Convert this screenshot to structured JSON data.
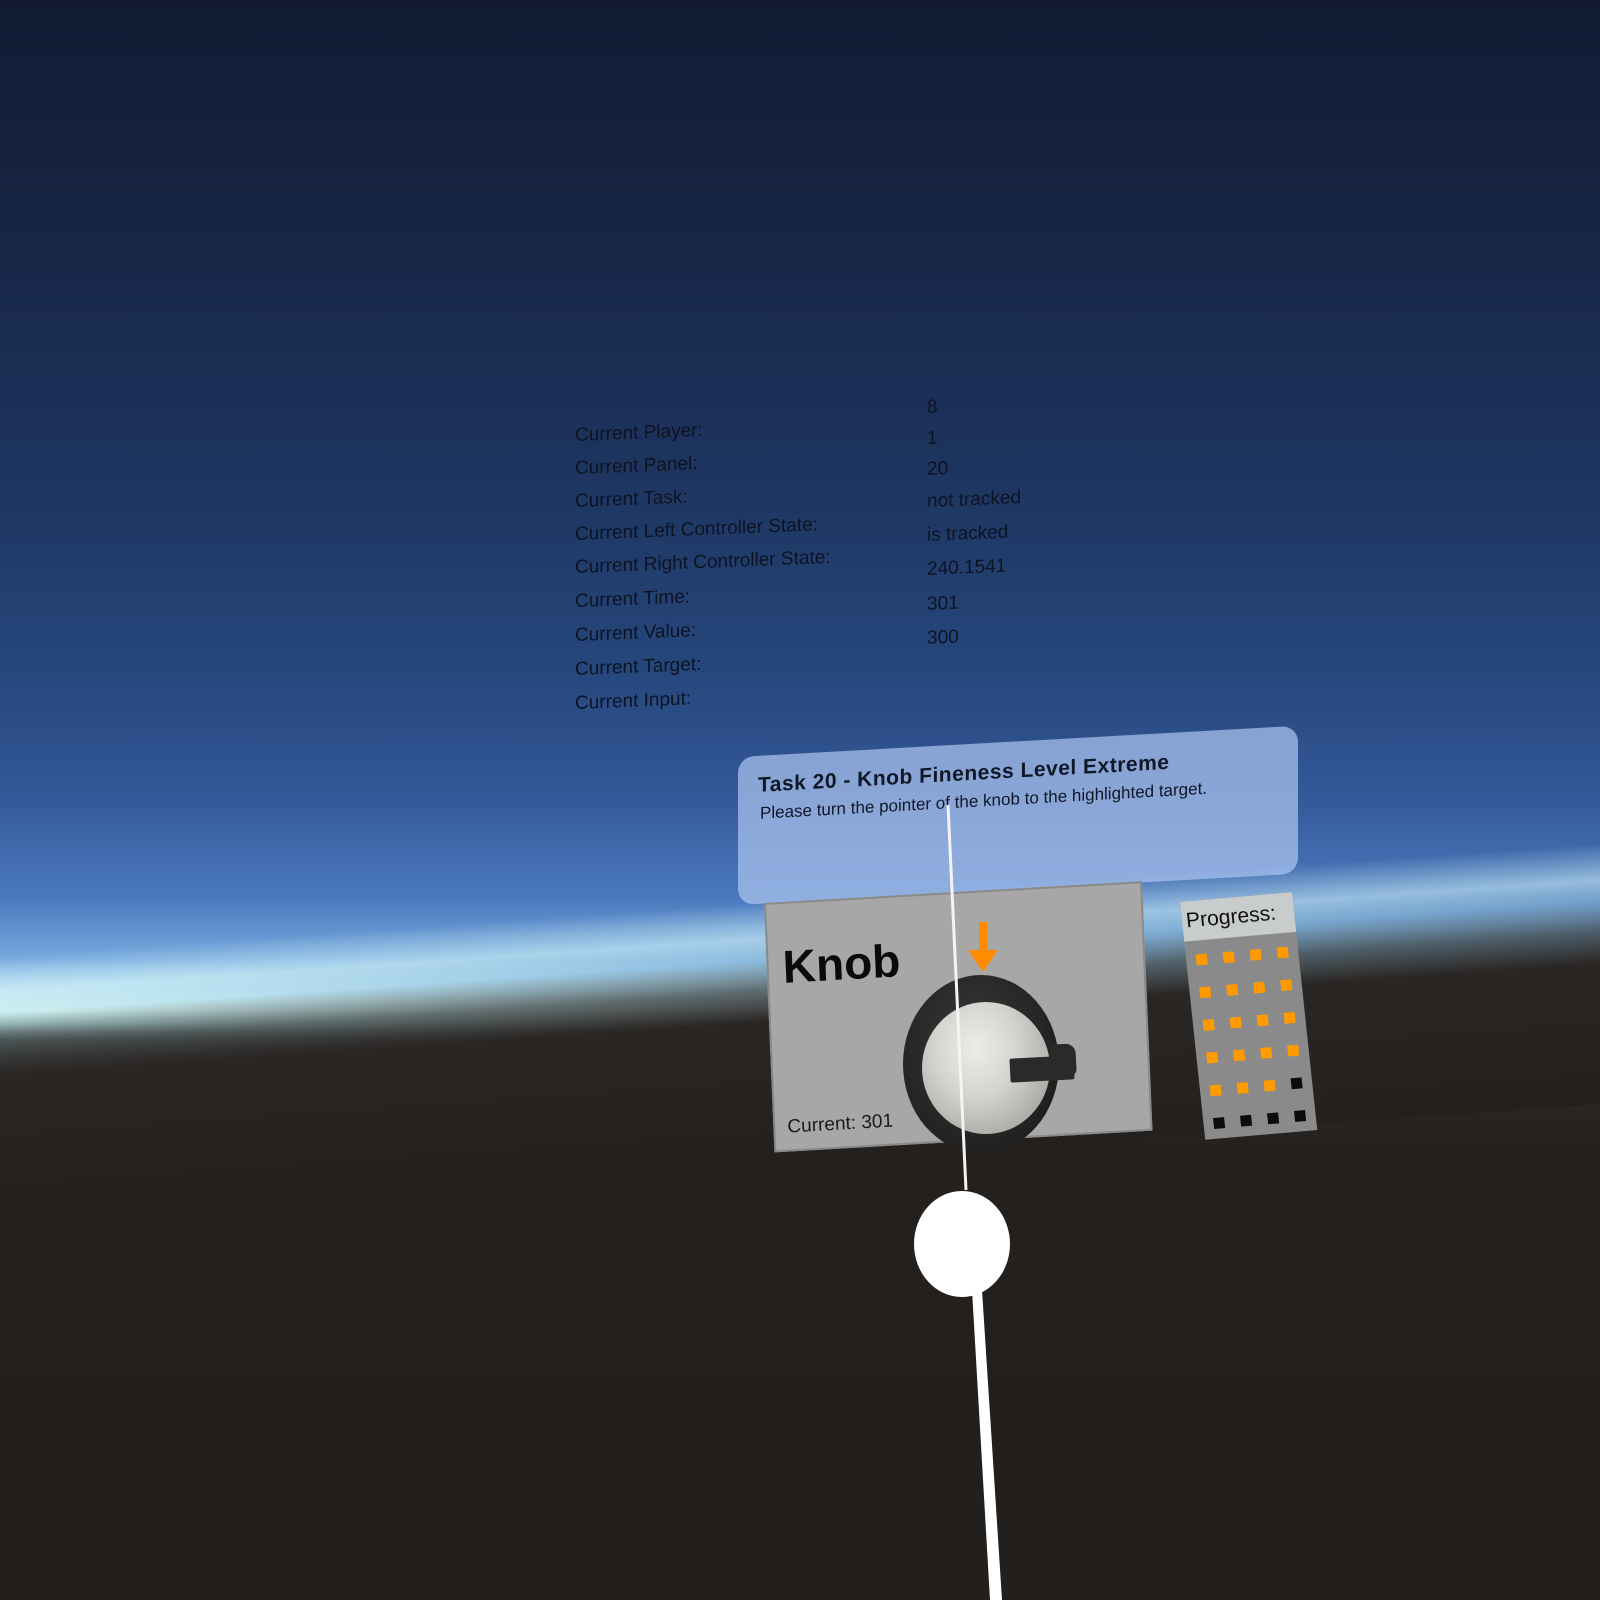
{
  "debug": {
    "rows": [
      {
        "label": "Current Player:",
        "value": "8"
      },
      {
        "label": "Current Panel:",
        "value": "1"
      },
      {
        "label": "Current Task:",
        "value": "20"
      },
      {
        "label": "Current Left Controller State:",
        "value": "not tracked"
      },
      {
        "label": "Current Right Controller State:",
        "value": "is tracked"
      },
      {
        "label": "Current Time:",
        "value": "240.1541"
      },
      {
        "label": "Current Value:",
        "value": "301"
      },
      {
        "label": "Current Target:",
        "value": "300"
      },
      {
        "label": "Current Input:",
        "value": ""
      }
    ]
  },
  "instruction": {
    "title": "Task 20 - Knob Fineness Level Extreme",
    "description": "Please turn the pointer of the knob to the highlighted target."
  },
  "knob_panel": {
    "title": "Knob",
    "current": "Current: 301",
    "target_marker_color": "#ff8c00"
  },
  "progress": {
    "label": "Progress:",
    "completed": 19,
    "total": 24,
    "done_color": "#ff9a00",
    "todo_color": "#0c0c0c"
  },
  "icons": {
    "target": "down-arrow-icon",
    "cursor": "controller-cursor-icon"
  }
}
